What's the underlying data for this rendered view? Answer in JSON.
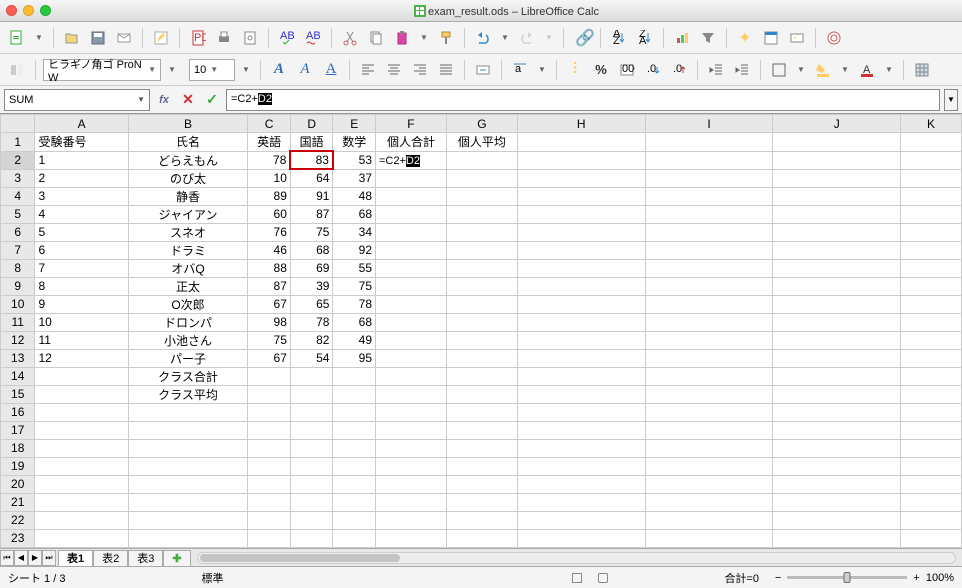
{
  "window": {
    "title": "exam_result.ods – LibreOffice Calc"
  },
  "toolbar2": {
    "font_name": "ヒラギノ角ゴ ProN W",
    "font_size": "10"
  },
  "formula": {
    "cell_ref": "SUM",
    "input_a": "=C2+",
    "input_b": "D2"
  },
  "cols": [
    "A",
    "B",
    "C",
    "D",
    "E",
    "F",
    "G",
    "H",
    "I",
    "J",
    "K"
  ],
  "sheet": {
    "header": [
      "受験番号",
      "氏名",
      "英語",
      "国語",
      "数学",
      "個人合計",
      "個人平均"
    ],
    "f2": {
      "a": "=C2+",
      "b": "D2"
    },
    "rows": [
      {
        "n": "1",
        "name": "どらえもん",
        "c": "78",
        "d": "83",
        "e": "53"
      },
      {
        "n": "2",
        "name": "のび太",
        "c": "10",
        "d": "64",
        "e": "37"
      },
      {
        "n": "3",
        "name": "静香",
        "c": "89",
        "d": "91",
        "e": "48"
      },
      {
        "n": "4",
        "name": "ジャイアン",
        "c": "60",
        "d": "87",
        "e": "68"
      },
      {
        "n": "5",
        "name": "スネオ",
        "c": "76",
        "d": "75",
        "e": "34"
      },
      {
        "n": "6",
        "name": "ドラミ",
        "c": "46",
        "d": "68",
        "e": "92"
      },
      {
        "n": "7",
        "name": "オバQ",
        "c": "88",
        "d": "69",
        "e": "55"
      },
      {
        "n": "8",
        "name": "正太",
        "c": "87",
        "d": "39",
        "e": "75"
      },
      {
        "n": "9",
        "name": "O次郎",
        "c": "67",
        "d": "65",
        "e": "78"
      },
      {
        "n": "10",
        "name": "ドロンパ",
        "c": "98",
        "d": "78",
        "e": "68"
      },
      {
        "n": "11",
        "name": "小池さん",
        "c": "75",
        "d": "82",
        "e": "49"
      },
      {
        "n": "12",
        "name": "パー子",
        "c": "67",
        "d": "54",
        "e": "95"
      }
    ],
    "footer": [
      "クラス合計",
      "クラス平均"
    ]
  },
  "tabs": {
    "t1": "表1",
    "t2": "表2",
    "t3": "表3"
  },
  "status": {
    "sheet": "シート 1 / 3",
    "mode": "標準",
    "sum": "合計=0",
    "zoom": "100%",
    "minus": "−",
    "plus": "+"
  }
}
